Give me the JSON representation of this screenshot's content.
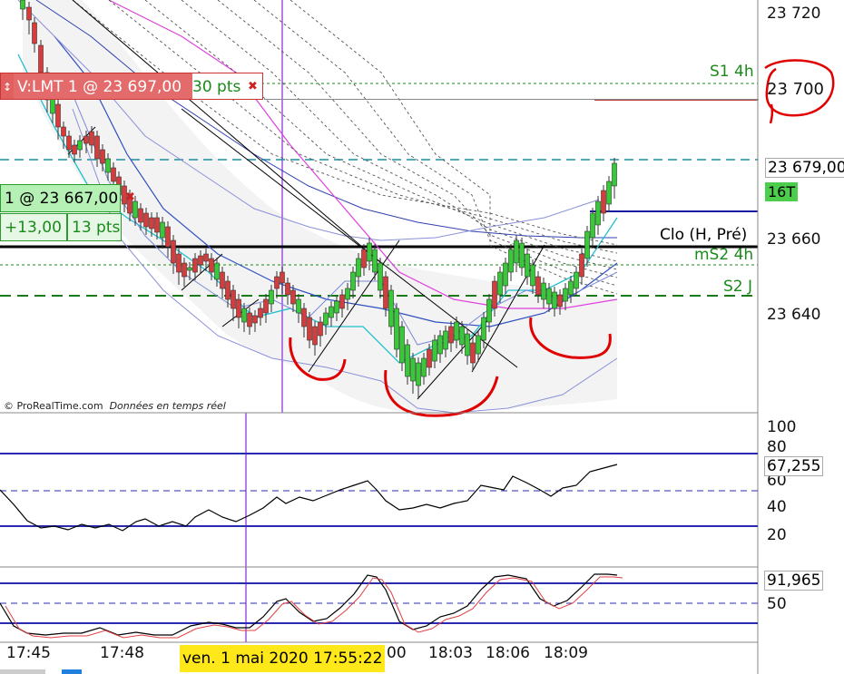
{
  "orders": {
    "sell_limit": {
      "label": "V:LMT 1 @ 23 697,00",
      "points": "30 pts",
      "close_glyph": "✖",
      "arrow_glyph": "↕"
    },
    "position": {
      "label": "1 @ 23 667,00",
      "close_glyph": "✖",
      "pnl": "+13,00",
      "points": "13 pts"
    }
  },
  "price_axis": {
    "ticks": [
      "23 720",
      "23 700",
      "23 660",
      "23 640"
    ],
    "current_price": "23 679,00",
    "timer": "16T"
  },
  "levels": {
    "s1_4h": "S1 4h",
    "clo": "Clo (H, Pré)",
    "ms2_4h": "mS2 4h",
    "s2_j": "S2 J"
  },
  "rsi_panel": {
    "ticks": [
      "100",
      "80",
      "60",
      "40",
      "20"
    ],
    "value": "67,255"
  },
  "stoch_panel": {
    "ticks": [
      "50"
    ],
    "value": "91,965"
  },
  "time_axis": {
    "labels": [
      "17:45",
      "17:48",
      "00",
      "18:03",
      "18:06",
      "18:09"
    ],
    "cursor": "ven. 1 mai 2020 17:55:22"
  },
  "copyright": {
    "brand": "© ProRealTime.com",
    "note": "Données en temps réel"
  },
  "colors": {
    "bull": "#33cc33",
    "bear": "#d93a3a",
    "annotation": "#e00000",
    "level_green": "#1a8a1a",
    "band_fill": "#f3f3f3"
  }
}
